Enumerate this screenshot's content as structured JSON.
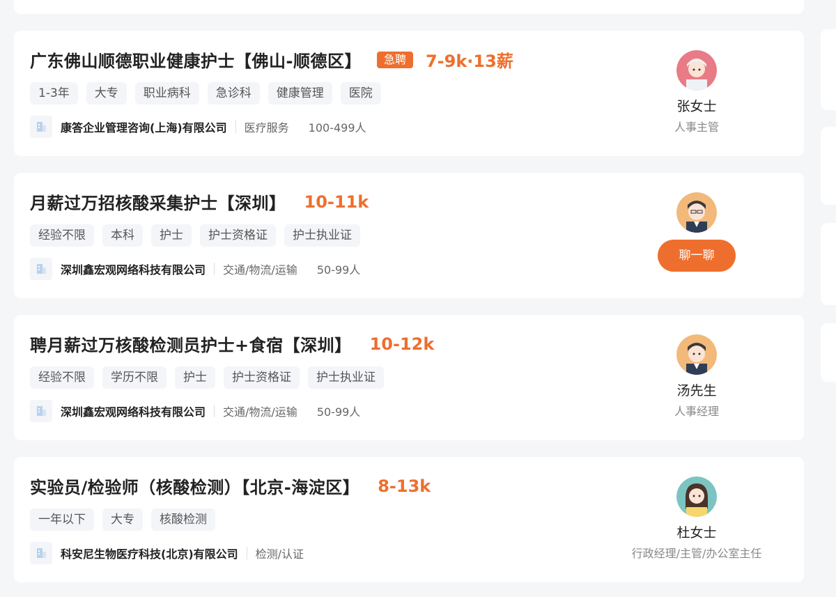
{
  "jobs": [
    {
      "title": "广东佛山顺德职业健康护士【佛山-顺德区】",
      "badge": "急聘",
      "salary": "7-9k·13薪",
      "tags": [
        "1-3年",
        "大专",
        "职业病科",
        "急诊科",
        "健康管理",
        "医院"
      ],
      "company": "康答企业管理咨询(上海)有限公司",
      "industry": "医疗服务",
      "size": "100-499人",
      "recruiter": {
        "name": "张女士",
        "role": "人事主管",
        "avatar": "female-avatar-icon"
      }
    },
    {
      "title": "月薪过万招核酸采集护士【深圳】",
      "salary": "10-11k",
      "tags": [
        "经验不限",
        "本科",
        "护士",
        "护士资格证",
        "护士执业证"
      ],
      "company": "深圳鑫宏观网络科技有限公司",
      "industry": "交通/物流/运输",
      "size": "50-99人",
      "recruiter": {
        "avatar": "male-avatar-icon"
      },
      "chat_label": "聊一聊"
    },
    {
      "title": "聘月薪过万核酸检测员护士+食宿【深圳】",
      "salary": "10-12k",
      "tags": [
        "经验不限",
        "学历不限",
        "护士",
        "护士资格证",
        "护士执业证"
      ],
      "company": "深圳鑫宏观网络科技有限公司",
      "industry": "交通/物流/运输",
      "size": "50-99人",
      "recruiter": {
        "name": "汤先生",
        "role": "人事经理",
        "avatar": "male-avatar-icon"
      }
    },
    {
      "title": "实验员/检验师（核酸检测）【北京-海淀区】",
      "salary": "8-13k",
      "tags": [
        "一年以下",
        "大专",
        "核酸检测"
      ],
      "company": "科安尼生物医疗科技(北京)有限公司",
      "industry": "检测/认证",
      "recruiter": {
        "name": "杜女士",
        "role": "行政经理/主管/办公室主任",
        "avatar": "female-avatar-icon"
      }
    }
  ],
  "colors": {
    "accent": "#ee6f2d",
    "background": "#f5f6f8",
    "card": "#ffffff",
    "tag_bg": "#f3f5f8"
  }
}
